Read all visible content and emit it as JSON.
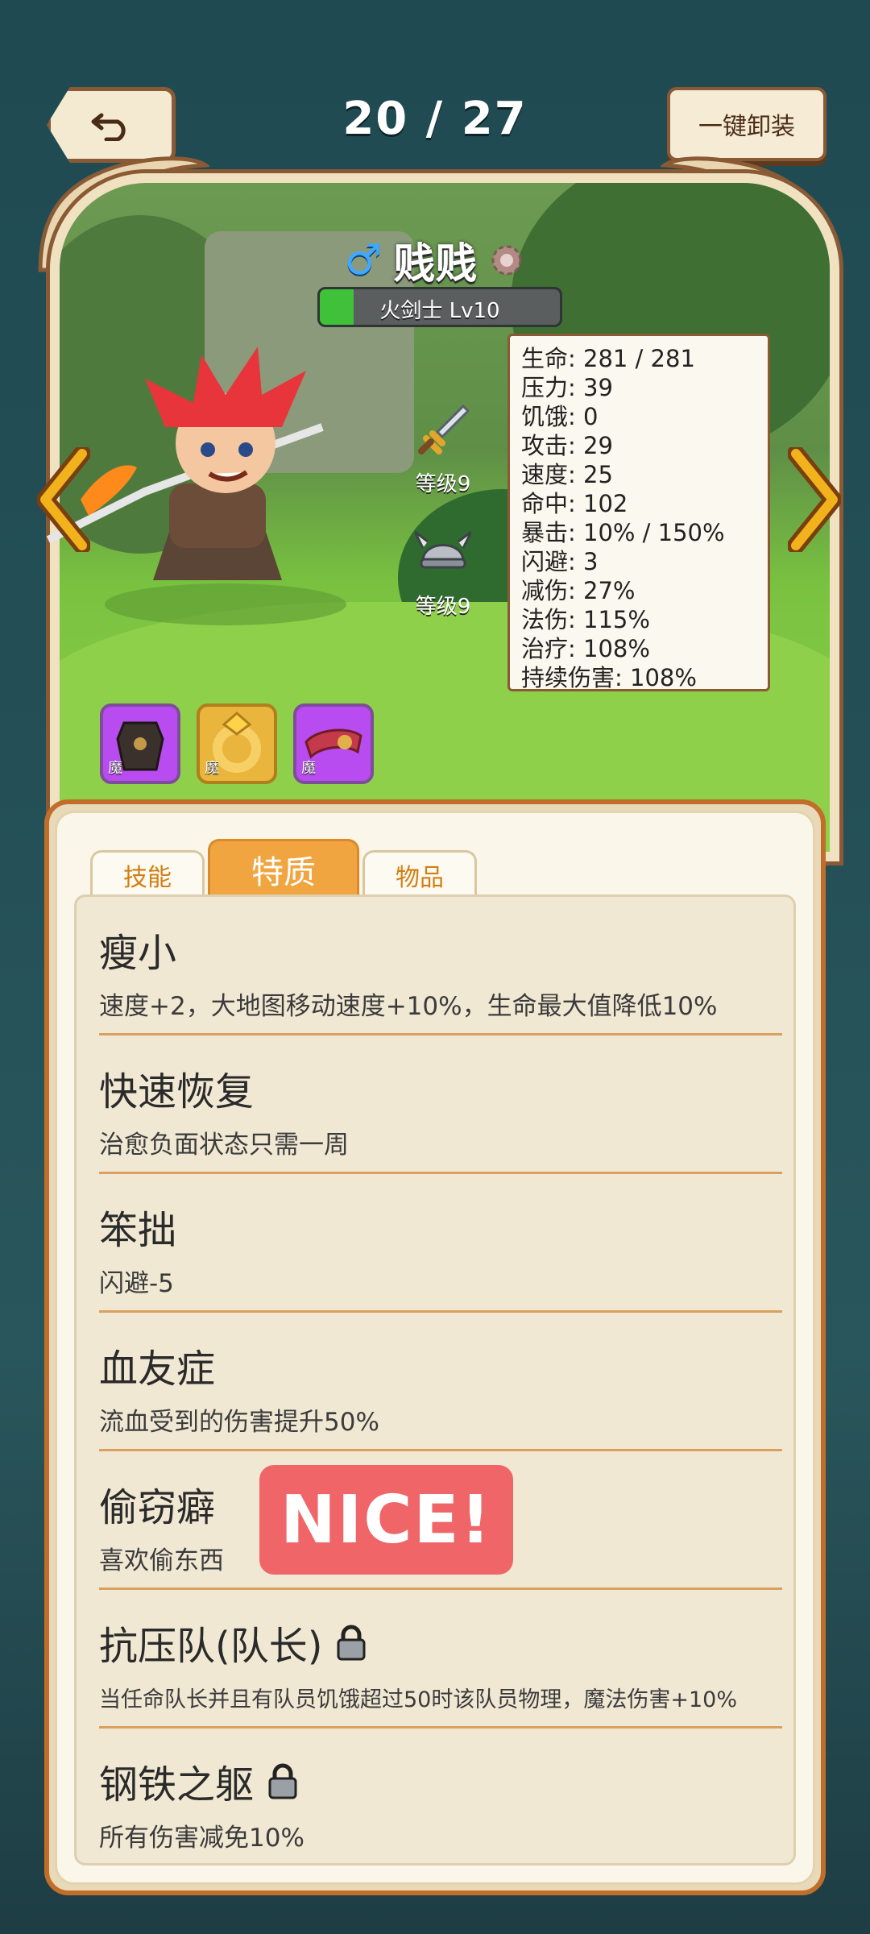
{
  "header": {
    "counter": "20 / 27",
    "unequip_label": "一键卸装"
  },
  "hero": {
    "gender_symbol": "♂",
    "name": "贱贱",
    "class_label": "火剑士 Lv10",
    "class_progress": 0.14
  },
  "stats": [
    "生命: 281 / 281",
    "压力: 39",
    "饥饿: 0",
    "攻击: 29",
    "速度: 25",
    "命中: 102",
    "暴击: 10% / 150%",
    "闪避: 3",
    "减伤: 27%",
    "法伤: 115%",
    "治疗: 108%",
    "持续伤害: 108%"
  ],
  "equipment": [
    {
      "icon": "sword-icon",
      "label": "等级9"
    },
    {
      "icon": "helmet-icon",
      "label": "等级9"
    }
  ],
  "items": [
    {
      "icon": "armor-item-icon",
      "tag": "魔",
      "color": "#b84cf0"
    },
    {
      "icon": "ring-item-icon",
      "tag": "魔",
      "color": "#e9b53d"
    },
    {
      "icon": "bracer-item-icon",
      "tag": "魔",
      "color": "#b84cf0"
    }
  ],
  "tabs": [
    {
      "label": "技能",
      "active": false
    },
    {
      "label": "特质",
      "active": true
    },
    {
      "label": "物品",
      "active": false
    }
  ],
  "traits": [
    {
      "title": "瘦小",
      "desc": "速度+2，大地图移动速度+10%，生命最大值降低10%",
      "locked": false
    },
    {
      "title": "快速恢复",
      "desc": "治愈负面状态只需一周",
      "locked": false
    },
    {
      "title": "笨拙",
      "desc": "闪避-5",
      "locked": false
    },
    {
      "title": "血友症",
      "desc": "流血受到的伤害提升50%",
      "locked": false
    },
    {
      "title": "偷窃癖",
      "desc": "喜欢偷东西",
      "locked": false
    },
    {
      "title": "抗压队(队长)",
      "desc": "当任命队长并且有队员饥饿超过50时该队员物理，魔法伤害+10%",
      "locked": true
    },
    {
      "title": "钢铁之躯",
      "desc": "所有伤害减免10%",
      "locked": true
    }
  ],
  "overlay": {
    "text": "NICE!"
  },
  "colors": {
    "accent": "#f0a540",
    "panel_border": "#c26e2b",
    "overlay": "#f06668"
  }
}
